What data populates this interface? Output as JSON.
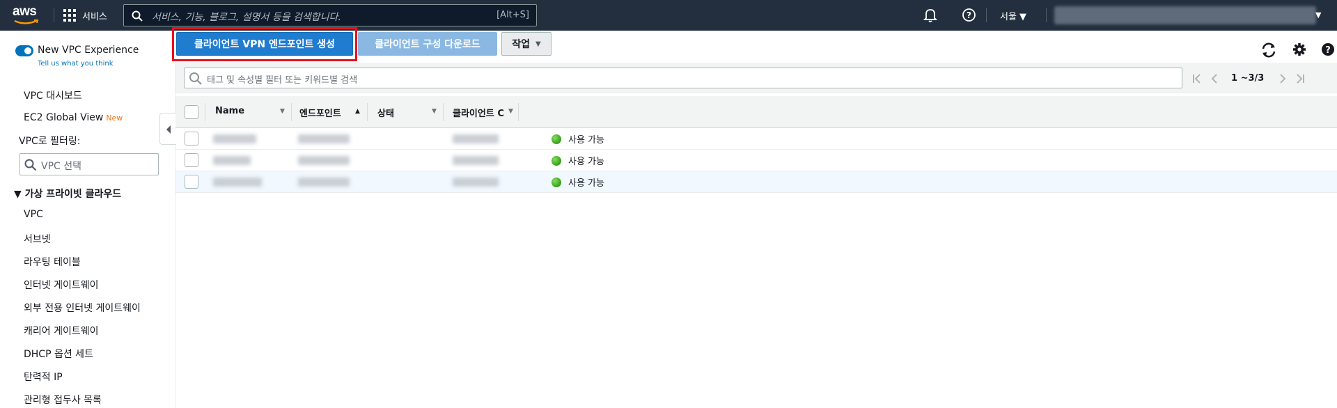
{
  "topnav": {
    "logo_text": "aws",
    "services_label": "서비스",
    "search_placeholder": "서비스, 기능, 블로그, 설명서 등을 검색합니다.",
    "search_shortcut": "[Alt+S]",
    "region_label": "서울 ▼",
    "account_caret": "▼"
  },
  "sidebar": {
    "toggle_label": "New VPC Experience",
    "toggle_link": "Tell us what you think",
    "items_top": [
      "VPC 대시보드",
      "EC2 Global View"
    ],
    "new_badge": "New",
    "filter_label": "VPC로 필터링:",
    "vpc_select_placeholder": "VPC 선택",
    "section_title": "▼ 가상 프라이빗 클라우드",
    "section_items": [
      "VPC",
      "서브넷",
      "라우팅 테이블",
      "인터넷 게이트웨이",
      "외부 전용 인터넷 게이트웨이",
      "캐리어 게이트웨이",
      "DHCP 옵션 세트",
      "탄력적 IP",
      "관리형 접두사 목록"
    ]
  },
  "toolbar": {
    "create_label": "클라이언트 VPN 엔드포인트 생성",
    "download_label": "클라이언트 구성 다운로드",
    "actions_label": "작업"
  },
  "filter": {
    "placeholder": "태그 및 속성별 필터 또는 키워드별 검색",
    "page_count": "1 ~3/3"
  },
  "table": {
    "columns": [
      "Name",
      "엔드포인트",
      "상태",
      "클라이언트 C"
    ],
    "rows": [
      {
        "status": "사용 가능"
      },
      {
        "status": "사용 가능"
      },
      {
        "status": "사용 가능"
      }
    ]
  }
}
